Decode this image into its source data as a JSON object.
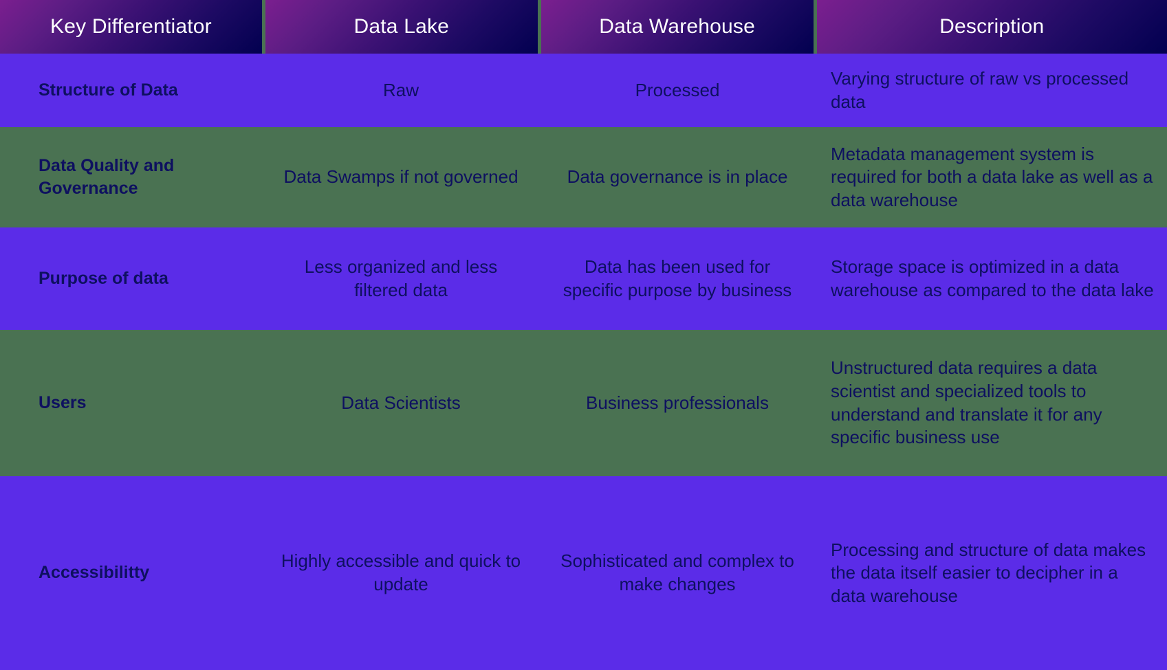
{
  "table": {
    "columns": [
      {
        "id": "key",
        "label": "Key Differentiator"
      },
      {
        "id": "lake",
        "label": "Data Lake"
      },
      {
        "id": "warehouse",
        "label": "Data Warehouse"
      },
      {
        "id": "description",
        "label": "Description"
      }
    ],
    "rows": [
      {
        "key": "Structure of Data",
        "lake": "Raw",
        "warehouse": "Processed",
        "description": "Varying structure of raw vs processed data"
      },
      {
        "key": "Data Quality and Governance",
        "lake": "Data Swamps if not governed",
        "warehouse": "Data governance is in place",
        "description": "Metadata management system is required for both a data lake as well as a data warehouse"
      },
      {
        "key": "Purpose of data",
        "lake": "Less organized and less filtered data",
        "warehouse": "Data has been used for specific purpose by business",
        "description": "Storage space is optimized in a data warehouse as compared to the data lake"
      },
      {
        "key": "Users",
        "lake": "Data Scientists",
        "warehouse": "Business professionals",
        "description": "Unstructured data requires a data scientist and specialized tools to understand and translate it for any specific business use"
      },
      {
        "key": "Accessibilitty",
        "lake": "Highly accessible and quick to update",
        "warehouse": "Sophisticated and complex to make changes",
        "description": "Processing and structure of data makes the data itself easier to decipher in a data warehouse"
      }
    ]
  },
  "colors": {
    "header_gradient_start": "#7b1f8f",
    "header_gradient_end": "#020050",
    "header_text": "#ffffff",
    "row_odd_background": "#5b2ce8",
    "row_even_background": "#4a7252",
    "body_text": "#0e1060"
  }
}
